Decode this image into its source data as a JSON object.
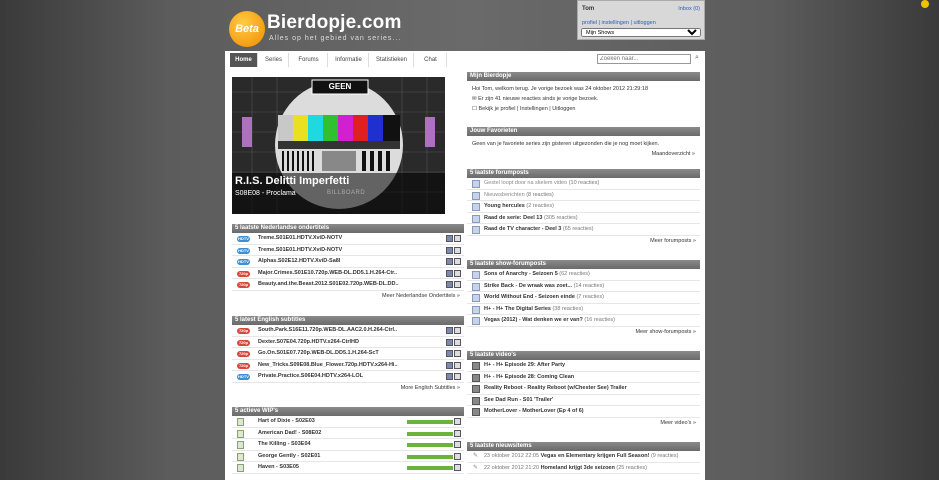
{
  "site": {
    "badge": "Beta",
    "name": "Bierdopje.com",
    "tagline": "Alles op het gebied van series..."
  },
  "user": {
    "name": "Tom",
    "inbox": "Inbox (0)",
    "links": "profiel | instellingen | uitloggen",
    "select_value": "Mijn Shows"
  },
  "tabs": [
    "Home",
    "Series",
    "Forums",
    "Informatie",
    "Statistieken",
    "Chat"
  ],
  "search": {
    "placeholder": "Zoeken naar..."
  },
  "feature": {
    "banner": "GEEN",
    "title": "R.I.S. Delitti Imperfetti",
    "episode": "S08E08 - Proclama",
    "sub": "BILLBOARD"
  },
  "nl_subs": {
    "header": "5 laatste Nederlandse ondertitels",
    "rows": [
      {
        "lang": "HDTV",
        "title": "Treme.S01E01.HDTV.XviD-NOTV"
      },
      {
        "lang": "HDTV",
        "title": "Treme.S01E01.HDTV.XviD-NOTV"
      },
      {
        "lang": "HDTV",
        "title": "Alphas.S02E12.HDTV.XviD-Sa8l"
      },
      {
        "lang": "720p",
        "title": "Major.Crimes.S01E10.720p.WEB-DL.DD5.1.H.264-Ctr.."
      },
      {
        "lang": "720p",
        "title": "Beauty.and.the.Beast.2012.S01E02.720p.WEB-DL.DD.."
      }
    ],
    "more": "Meer Nederlandse Ondertitels »"
  },
  "en_subs": {
    "header": "5 latest English subtitles",
    "rows": [
      {
        "lang": "720p",
        "title": "South.Park.S16E11.720p.WEB-DL.AAC2.0.H.264-Ctrl.."
      },
      {
        "lang": "720p",
        "title": "Dexter.S07E04.720p.HDTV.x264-CtrlHD"
      },
      {
        "lang": "720p",
        "title": "Go.On.S01E07.720p.WEB-DL.DD5.1.H.264-ScT"
      },
      {
        "lang": "720p",
        "title": "New_Tricks.S09E08.Blue_Flower.720p.HDTV.x264-Hi.."
      },
      {
        "lang": "HDTV",
        "title": "Private.Practice.S06E04.HDTV.x264-LOL"
      }
    ],
    "more": "More English Subtitles »"
  },
  "wip": {
    "header": "5 actieve WIP's",
    "rows": [
      {
        "title": "Hart of Dixie - S02E03",
        "progress": 0.95
      },
      {
        "title": "American Dad! - S08E02",
        "progress": 0.95
      },
      {
        "title": "The Killing - S03E04",
        "progress": 0.95
      },
      {
        "title": "George Gently - S02E01",
        "progress": 0.95
      },
      {
        "title": "Haven - S03E05",
        "progress": 0.95
      }
    ]
  },
  "mijn": {
    "header": "Mijn Bierdopje",
    "welcome": "Hoi Tom, welkom terug. Je vorige bezoek was 24 oktober 2012 21:29:18",
    "new_reactions": "Er zijn 41 nieuwe reacties sinds je vorige bezoek.",
    "links": "Bekijk je profiel | Instellingen | Uitloggen"
  },
  "favorieten": {
    "header": "Jouw Favorieten",
    "text": "Geen van je favoriete series zijn gisteren uitgezonden die je nog moet kijken.",
    "more": "Maandoverzicht »"
  },
  "forum": {
    "header": "5 laatste forumposts",
    "rows": [
      {
        "title": "Gestel loopt door na skelem video",
        "count": "(10 reacties)"
      },
      {
        "title": "Nieuwsberichten",
        "count": "(8 reacties)"
      },
      {
        "title": "Young hercules",
        "count": "(2 reacties)"
      },
      {
        "title": "Raad de serie: Deel 13",
        "count": "(305 reacties)"
      },
      {
        "title": "Raad de TV character - Deel 3",
        "count": "(65 reacties)"
      }
    ],
    "more": "Meer forumposts »"
  },
  "show_forum": {
    "header": "5 laatste show-forumposts",
    "rows": [
      {
        "title": "Sons of Anarchy - Seizoen 5",
        "count": "(62 reacties)"
      },
      {
        "title": "Strike Back - De wraak was zoet...",
        "count": "(14 reacties)"
      },
      {
        "title": "World Without End - Seizoen einde",
        "count": "(7 reacties)"
      },
      {
        "title": "H+ - H+ The Digital Series",
        "count": "(38 reacties)"
      },
      {
        "title": "Vegas (2012) - Wat denken we er van?",
        "count": "(16 reacties)"
      }
    ],
    "more": "Meer show-forumposts »"
  },
  "videos": {
    "header": "5 laatste video's",
    "rows": [
      {
        "title": "H+ - H+ Episode 29: After Party"
      },
      {
        "title": "H+ - H+ Episode 28: Coming Clean"
      },
      {
        "title": "Reality Reboot - Reality Reboot (w/Chester See) Trailer"
      },
      {
        "title": "See Dad Run - S01 'Trailer'"
      },
      {
        "title": "MotherLover - MotherLover (Ep 4 of 6)"
      }
    ],
    "more": "Meer video's »"
  },
  "news": {
    "header": "5 laatste nieuwsitems",
    "rows": [
      {
        "date": "23 oktober 2012 22:05",
        "title": "Vegas en Elementary krijgen Full Season!",
        "count": "(9 reacties)"
      },
      {
        "date": "22 oktober 2012 21:20",
        "title": "Homeland krijgt 3de seizoen",
        "count": "(25 reacties)"
      }
    ]
  }
}
